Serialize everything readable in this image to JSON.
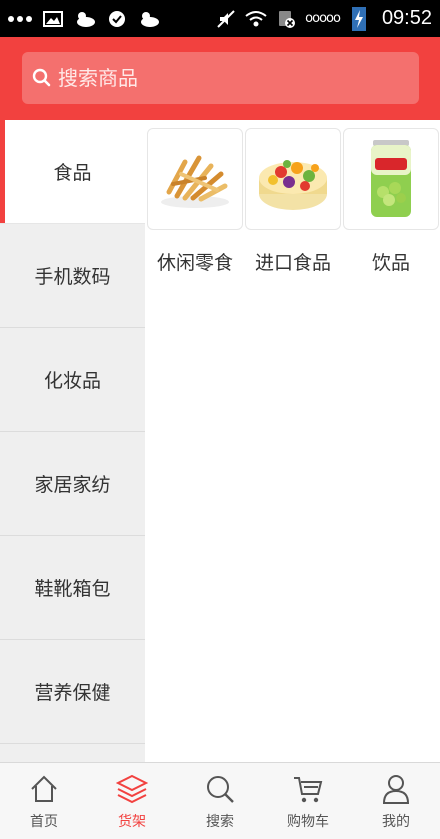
{
  "status_bar": {
    "time": "09:52",
    "signal_text": "ooooo",
    "icons": [
      "more-dots-icon",
      "image-icon",
      "weather-icon",
      "check-icon",
      "weather-icon",
      "mute-icon",
      "wifi-icon",
      "no-sim-icon",
      "signal-icon",
      "battery-charging-icon"
    ]
  },
  "search": {
    "placeholder": "搜索商品",
    "value": ""
  },
  "categories": [
    {
      "label": "食品",
      "active": true
    },
    {
      "label": "手机数码",
      "active": false
    },
    {
      "label": "化妆品",
      "active": false
    },
    {
      "label": "家居家纺",
      "active": false
    },
    {
      "label": "鞋靴箱包",
      "active": false
    },
    {
      "label": "营养保健",
      "active": false
    }
  ],
  "products": [
    {
      "label": "休闲零食",
      "image": "fries-snack-image"
    },
    {
      "label": "进口食品",
      "image": "fruit-cake-image"
    },
    {
      "label": "饮品",
      "image": "grape-drink-can-image"
    }
  ],
  "bottom_nav": [
    {
      "label": "首页",
      "icon": "home-icon",
      "active": false
    },
    {
      "label": "货架",
      "icon": "layers-icon",
      "active": true
    },
    {
      "label": "搜索",
      "icon": "search-icon",
      "active": false
    },
    {
      "label": "购物车",
      "icon": "cart-icon",
      "active": false
    },
    {
      "label": "我的",
      "icon": "user-icon",
      "active": false
    }
  ],
  "colors": {
    "accent": "#f2413f",
    "search_box": "#f4706e",
    "sidebar_bg": "#efefef",
    "nav_inactive": "#555555"
  }
}
